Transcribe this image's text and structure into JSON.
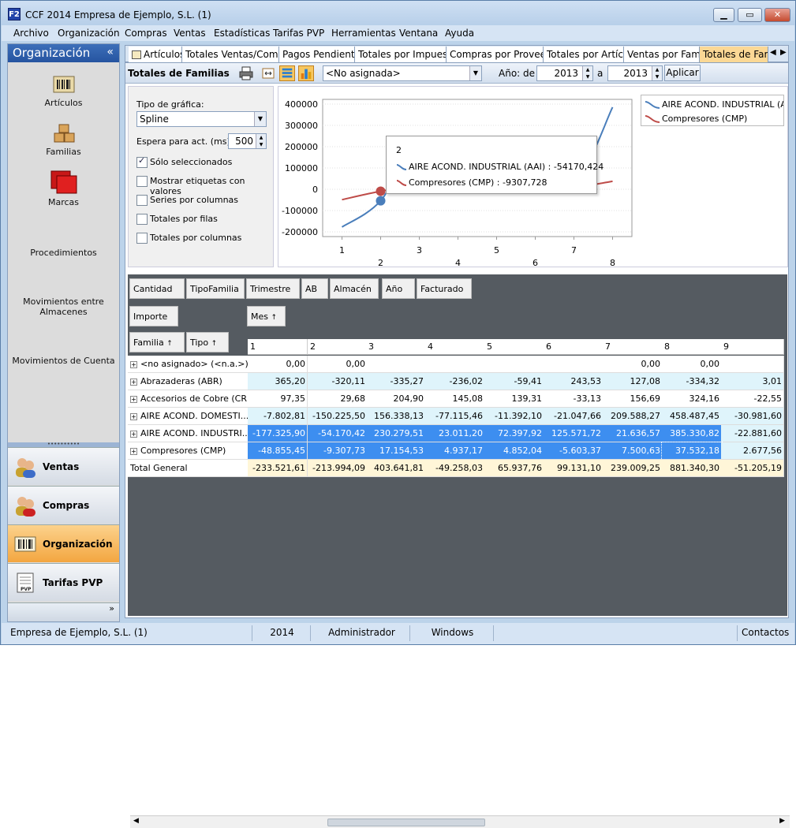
{
  "window": {
    "title": "CCF 2014 Empresa de Ejemplo, S.L. (1)",
    "icon_text": "F2"
  },
  "menu": [
    "Archivo",
    "Organización",
    "Compras",
    "Ventas",
    "Estadísticas",
    "Tarifas PVP",
    "Herramientas",
    "Ventana",
    "Ayuda"
  ],
  "sidebar": {
    "title": "Organización",
    "collapse": "«",
    "items": [
      "Artículos",
      "Familias",
      "Marcas",
      "Procedimientos",
      "Movimientos entre Almacenes",
      "Movimientos de Cuenta"
    ],
    "nav": [
      "Ventas",
      "Compras",
      "Organización",
      "Tarifas PVP"
    ],
    "nav_active": "Organización",
    "more": "»"
  },
  "tabs": [
    "Artículos",
    "Totales Ventas/Compras",
    "Pagos Pendientes",
    "Totales por Impuestos",
    "Compras por Proveedor",
    "Totales por Artículo",
    "Ventas por Familia",
    "Totales de Familia"
  ],
  "tabs_active": "Totales de Familia",
  "toolbar": {
    "title": "Totales de Familias",
    "filter": "<No asignada>",
    "year_label": "Año: de",
    "year_from": "2013",
    "year_to_label": "a",
    "year_to": "2013",
    "apply": "Aplicar"
  },
  "options": {
    "chart_type_label": "Tipo de gráfica:",
    "chart_type": "Spline",
    "wait_label": "Espera para act. (ms):",
    "wait_value": "500",
    "checks": [
      {
        "label": "Sólo seleccionados",
        "checked": true
      },
      {
        "label": "Mostrar etiquetas con valores",
        "checked": false
      },
      {
        "label": "Series por columnas",
        "checked": false
      },
      {
        "label": "Totales por filas",
        "checked": false
      },
      {
        "label": "Totales por columnas",
        "checked": false
      }
    ]
  },
  "chart_data": {
    "type": "line",
    "x": [
      1,
      2,
      3,
      4,
      5,
      6,
      7,
      8
    ],
    "y_ticks": [
      "400000",
      "300000",
      "200000",
      "100000",
      "0",
      "-100000",
      "-200000"
    ],
    "ylim": [
      -200000,
      400000
    ],
    "series": [
      {
        "name": "AIRE ACOND. INDUSTRIAL (AAI)",
        "color": "#4a7ebb",
        "values": [
          -177325.9,
          -54170.42,
          230279.51,
          23011.2,
          72397.92,
          125571.72,
          21636.57,
          385330.82
        ]
      },
      {
        "name": "Compresores (CMP)",
        "color": "#be4b48",
        "values": [
          -48855.45,
          -9307.73,
          17154.53,
          4937.17,
          4852.04,
          -5603.37,
          7500.63,
          37532.18
        ]
      }
    ],
    "legend": "top-right",
    "tooltip": {
      "title": "2",
      "lines": [
        "AIRE ACOND. INDUSTRIAL (AAI) : -54170,424",
        "Compresores (CMP) : -9307,728"
      ]
    }
  },
  "pivot": {
    "filter_fields": [
      "Cantidad",
      "TipoFamilia",
      "Trimestre",
      "AB",
      "Almacén",
      "Año",
      "Facturado"
    ],
    "data_field": "Importe",
    "column_field": "Mes",
    "row_fields": [
      "Familia",
      "Tipo"
    ],
    "columns": [
      "1",
      "2",
      "3",
      "4",
      "5",
      "6",
      "7",
      "8",
      "9"
    ],
    "rows": [
      {
        "label": "<no asignado> (<n.a.>)",
        "style": "white",
        "values": [
          "0,00",
          "0,00",
          "",
          "",
          "",
          "",
          "0,00",
          "0,00",
          ""
        ]
      },
      {
        "label": "Abrazaderas (ABR)",
        "style": "light",
        "values": [
          "365,20",
          "-320,11",
          "-335,27",
          "-236,02",
          "-59,41",
          "243,53",
          "127,08",
          "-334,32",
          "3,01"
        ]
      },
      {
        "label": "Accesorios de Cobre (CRB)",
        "style": "white",
        "values": [
          "97,35",
          "29,68",
          "204,90",
          "145,08",
          "139,31",
          "-33,13",
          "156,69",
          "324,16",
          "-22,55"
        ]
      },
      {
        "label": "AIRE ACOND. DOMESTI...",
        "style": "light",
        "values": [
          "-7.802,81",
          "-150.225,50",
          "156.338,13",
          "-77.115,46",
          "-11.392,10",
          "-21.047,66",
          "209.588,27",
          "458.487,45",
          "-30.981,60"
        ]
      },
      {
        "label": "AIRE ACOND. INDUSTRI...",
        "style": "blue",
        "values": [
          "-177.325,90",
          "-54.170,42",
          "230.279,51",
          "23.011,20",
          "72.397,92",
          "125.571,72",
          "21.636,57",
          "385.330,82",
          "-22.881,60"
        ]
      },
      {
        "label": "Compresores (CMP)",
        "style": "blue",
        "values": [
          "-48.855,45",
          "-9.307,73",
          "17.154,53",
          "4.937,17",
          "4.852,04",
          "-5.603,37",
          "7.500,63",
          "37.532,18",
          "2.677,56"
        ]
      },
      {
        "label": "Total General",
        "style": "total",
        "values": [
          "-233.521,61",
          "-213.994,09",
          "403.641,81",
          "-49.258,03",
          "65.937,76",
          "99.131,10",
          "239.009,25",
          "881.340,30",
          "-51.205,19"
        ]
      }
    ]
  },
  "status": [
    "Empresa de Ejemplo, S.L. (1)",
    "2014",
    "Administrador",
    "Windows",
    "Contactos"
  ]
}
